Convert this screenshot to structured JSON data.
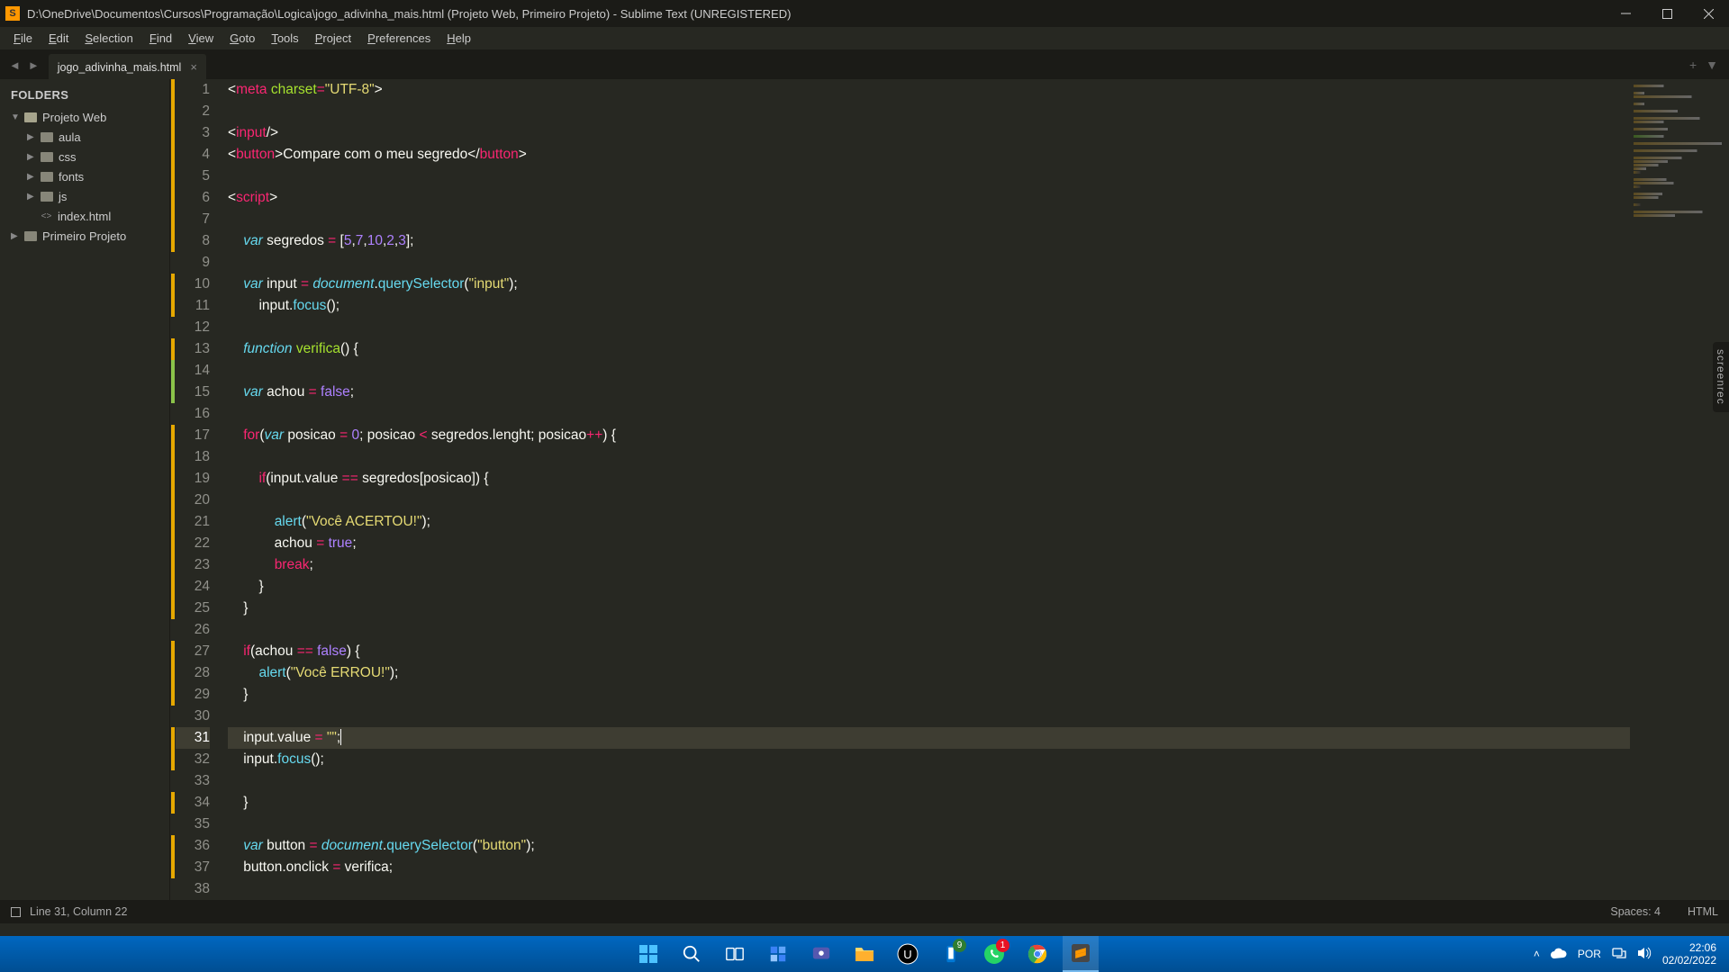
{
  "title": "D:\\OneDrive\\Documentos\\Cursos\\Programação\\Logica\\jogo_adivinha_mais.html (Projeto Web, Primeiro Projeto) - Sublime Text (UNREGISTERED)",
  "menu": [
    "File",
    "Edit",
    "Selection",
    "Find",
    "View",
    "Goto",
    "Tools",
    "Project",
    "Preferences",
    "Help"
  ],
  "sidebar": {
    "header": "FOLDERS",
    "items": [
      {
        "label": "Projeto Web",
        "depth": 0,
        "type": "folder",
        "open": true
      },
      {
        "label": "aula",
        "depth": 1,
        "type": "folder",
        "open": false
      },
      {
        "label": "css",
        "depth": 1,
        "type": "folder",
        "open": false
      },
      {
        "label": "fonts",
        "depth": 1,
        "type": "folder",
        "open": false
      },
      {
        "label": "js",
        "depth": 1,
        "type": "folder",
        "open": false
      },
      {
        "label": "index.html",
        "depth": 1,
        "type": "file"
      },
      {
        "label": "Primeiro Projeto",
        "depth": 0,
        "type": "folder",
        "open": false
      }
    ]
  },
  "tab": {
    "name": "jogo_adivinha_mais.html"
  },
  "status": {
    "pos": "Line 31, Column 22",
    "spaces": "Spaces: 4",
    "lang": "HTML"
  },
  "taskbar": {
    "lang": "POR",
    "time": "22:06",
    "date": "02/02/2022",
    "badges": {
      "phone": "9",
      "whatsapp": "1"
    }
  },
  "screenrec": "screenrec",
  "code_lines": [
    {
      "n": 1,
      "mark": "orange",
      "tokens": [
        [
          "c-punc",
          "<"
        ],
        [
          "c-tag",
          "meta"
        ],
        [
          "c-txt",
          " "
        ],
        [
          "c-attr",
          "charset"
        ],
        [
          "c-op",
          "="
        ],
        [
          "c-str",
          "\"UTF-8\""
        ],
        [
          "c-punc",
          ">"
        ]
      ]
    },
    {
      "n": 2,
      "mark": "orange",
      "tokens": []
    },
    {
      "n": 3,
      "mark": "orange",
      "tokens": [
        [
          "c-punc",
          "<"
        ],
        [
          "c-tag",
          "input"
        ],
        [
          "c-punc",
          "/>"
        ]
      ]
    },
    {
      "n": 4,
      "mark": "orange",
      "tokens": [
        [
          "c-punc",
          "<"
        ],
        [
          "c-tag",
          "button"
        ],
        [
          "c-punc",
          ">"
        ],
        [
          "c-txt",
          "Compare com o meu segredo"
        ],
        [
          "c-punc",
          "</"
        ],
        [
          "c-tag",
          "button"
        ],
        [
          "c-punc",
          ">"
        ]
      ]
    },
    {
      "n": 5,
      "mark": "orange",
      "tokens": []
    },
    {
      "n": 6,
      "mark": "orange",
      "tokens": [
        [
          "c-punc",
          "<"
        ],
        [
          "c-tag",
          "script"
        ],
        [
          "c-punc",
          ">"
        ]
      ]
    },
    {
      "n": 7,
      "mark": "orange",
      "tokens": []
    },
    {
      "n": 8,
      "mark": "orange",
      "tokens": [
        [
          "c-txt",
          "    "
        ],
        [
          "c-kw",
          "var"
        ],
        [
          "c-txt",
          " segredos "
        ],
        [
          "c-op",
          "="
        ],
        [
          "c-txt",
          " ["
        ],
        [
          "c-num",
          "5"
        ],
        [
          "c-txt",
          ","
        ],
        [
          "c-num",
          "7"
        ],
        [
          "c-txt",
          ","
        ],
        [
          "c-num",
          "10"
        ],
        [
          "c-txt",
          ","
        ],
        [
          "c-num",
          "2"
        ],
        [
          "c-txt",
          ","
        ],
        [
          "c-num",
          "3"
        ],
        [
          "c-txt",
          "];"
        ]
      ]
    },
    {
      "n": 9,
      "mark": "",
      "tokens": []
    },
    {
      "n": 10,
      "mark": "orange",
      "tokens": [
        [
          "c-txt",
          "    "
        ],
        [
          "c-kw",
          "var"
        ],
        [
          "c-txt",
          " input "
        ],
        [
          "c-op",
          "="
        ],
        [
          "c-txt",
          " "
        ],
        [
          "c-obj",
          "document"
        ],
        [
          "c-txt",
          "."
        ],
        [
          "c-fn",
          "querySelector"
        ],
        [
          "c-txt",
          "("
        ],
        [
          "c-str",
          "\"input\""
        ],
        [
          "c-txt",
          ");"
        ]
      ]
    },
    {
      "n": 11,
      "mark": "orange",
      "tokens": [
        [
          "c-txt",
          "        input."
        ],
        [
          "c-fn",
          "focus"
        ],
        [
          "c-txt",
          "();"
        ]
      ]
    },
    {
      "n": 12,
      "mark": "",
      "tokens": []
    },
    {
      "n": 13,
      "mark": "orange",
      "tokens": [
        [
          "c-txt",
          "    "
        ],
        [
          "c-kw",
          "function"
        ],
        [
          "c-txt",
          " "
        ],
        [
          "c-name",
          "verifica"
        ],
        [
          "c-txt",
          "() {"
        ]
      ]
    },
    {
      "n": 14,
      "mark": "green",
      "tokens": []
    },
    {
      "n": 15,
      "mark": "green",
      "tokens": [
        [
          "c-txt",
          "    "
        ],
        [
          "c-kw",
          "var"
        ],
        [
          "c-txt",
          " achou "
        ],
        [
          "c-op",
          "="
        ],
        [
          "c-txt",
          " "
        ],
        [
          "c-num",
          "false"
        ],
        [
          "c-txt",
          ";"
        ]
      ]
    },
    {
      "n": 16,
      "mark": "",
      "tokens": []
    },
    {
      "n": 17,
      "mark": "orange",
      "tokens": [
        [
          "c-txt",
          "    "
        ],
        [
          "c-storage",
          "for"
        ],
        [
          "c-txt",
          "("
        ],
        [
          "c-kw",
          "var"
        ],
        [
          "c-txt",
          " posicao "
        ],
        [
          "c-op",
          "="
        ],
        [
          "c-txt",
          " "
        ],
        [
          "c-num",
          "0"
        ],
        [
          "c-txt",
          "; posicao "
        ],
        [
          "c-op",
          "<"
        ],
        [
          "c-txt",
          " segredos.lenght; posicao"
        ],
        [
          "c-op",
          "++"
        ],
        [
          "c-txt",
          ") {"
        ]
      ]
    },
    {
      "n": 18,
      "mark": "orange",
      "tokens": []
    },
    {
      "n": 19,
      "mark": "orange",
      "tokens": [
        [
          "c-txt",
          "        "
        ],
        [
          "c-storage",
          "if"
        ],
        [
          "c-txt",
          "(input.value "
        ],
        [
          "c-op",
          "=="
        ],
        [
          "c-txt",
          " segredos[posicao]) {"
        ]
      ]
    },
    {
      "n": 20,
      "mark": "orange",
      "tokens": []
    },
    {
      "n": 21,
      "mark": "orange",
      "tokens": [
        [
          "c-txt",
          "            "
        ],
        [
          "c-fn",
          "alert"
        ],
        [
          "c-txt",
          "("
        ],
        [
          "c-str",
          "\"Você ACERTOU!\""
        ],
        [
          "c-txt",
          ");"
        ]
      ]
    },
    {
      "n": 22,
      "mark": "orange",
      "tokens": [
        [
          "c-txt",
          "            achou "
        ],
        [
          "c-op",
          "="
        ],
        [
          "c-txt",
          " "
        ],
        [
          "c-num",
          "true"
        ],
        [
          "c-txt",
          ";"
        ]
      ]
    },
    {
      "n": 23,
      "mark": "orange",
      "tokens": [
        [
          "c-txt",
          "            "
        ],
        [
          "c-storage",
          "break"
        ],
        [
          "c-txt",
          ";"
        ]
      ]
    },
    {
      "n": 24,
      "mark": "orange",
      "tokens": [
        [
          "c-txt",
          "        }"
        ]
      ]
    },
    {
      "n": 25,
      "mark": "orange",
      "tokens": [
        [
          "c-txt",
          "    }"
        ]
      ]
    },
    {
      "n": 26,
      "mark": "",
      "tokens": []
    },
    {
      "n": 27,
      "mark": "orange",
      "tokens": [
        [
          "c-txt",
          "    "
        ],
        [
          "c-storage",
          "if"
        ],
        [
          "c-txt",
          "(achou "
        ],
        [
          "c-op",
          "=="
        ],
        [
          "c-txt",
          " "
        ],
        [
          "c-num",
          "false"
        ],
        [
          "c-txt",
          ") {"
        ]
      ]
    },
    {
      "n": 28,
      "mark": "orange",
      "tokens": [
        [
          "c-txt",
          "        "
        ],
        [
          "c-fn",
          "alert"
        ],
        [
          "c-txt",
          "("
        ],
        [
          "c-str",
          "\"Você ERROU!\""
        ],
        [
          "c-txt",
          ");"
        ]
      ]
    },
    {
      "n": 29,
      "mark": "orange",
      "tokens": [
        [
          "c-txt",
          "    }"
        ]
      ]
    },
    {
      "n": 30,
      "mark": "",
      "tokens": []
    },
    {
      "n": 31,
      "mark": "orange",
      "active": true,
      "tokens": [
        [
          "c-txt",
          "    input.value "
        ],
        [
          "c-op",
          "="
        ],
        [
          "c-txt",
          " "
        ],
        [
          "c-str",
          "\"\""
        ],
        [
          "c-txt",
          ";"
        ],
        [
          "caret",
          ""
        ]
      ]
    },
    {
      "n": 32,
      "mark": "orange",
      "tokens": [
        [
          "c-txt",
          "    input."
        ],
        [
          "c-fn",
          "focus"
        ],
        [
          "c-txt",
          "();"
        ]
      ]
    },
    {
      "n": 33,
      "mark": "",
      "tokens": []
    },
    {
      "n": 34,
      "mark": "orange",
      "tokens": [
        [
          "c-txt",
          "    }"
        ]
      ]
    },
    {
      "n": 35,
      "mark": "",
      "tokens": []
    },
    {
      "n": 36,
      "mark": "orange",
      "tokens": [
        [
          "c-txt",
          "    "
        ],
        [
          "c-kw",
          "var"
        ],
        [
          "c-txt",
          " button "
        ],
        [
          "c-op",
          "="
        ],
        [
          "c-txt",
          " "
        ],
        [
          "c-obj",
          "document"
        ],
        [
          "c-txt",
          "."
        ],
        [
          "c-fn",
          "querySelector"
        ],
        [
          "c-txt",
          "("
        ],
        [
          "c-str",
          "\"button\""
        ],
        [
          "c-txt",
          ");"
        ]
      ]
    },
    {
      "n": 37,
      "mark": "orange",
      "tokens": [
        [
          "c-txt",
          "    button.onclick "
        ],
        [
          "c-op",
          "="
        ],
        [
          "c-txt",
          " verifica;"
        ]
      ]
    },
    {
      "n": 38,
      "mark": "",
      "tokens": []
    }
  ]
}
